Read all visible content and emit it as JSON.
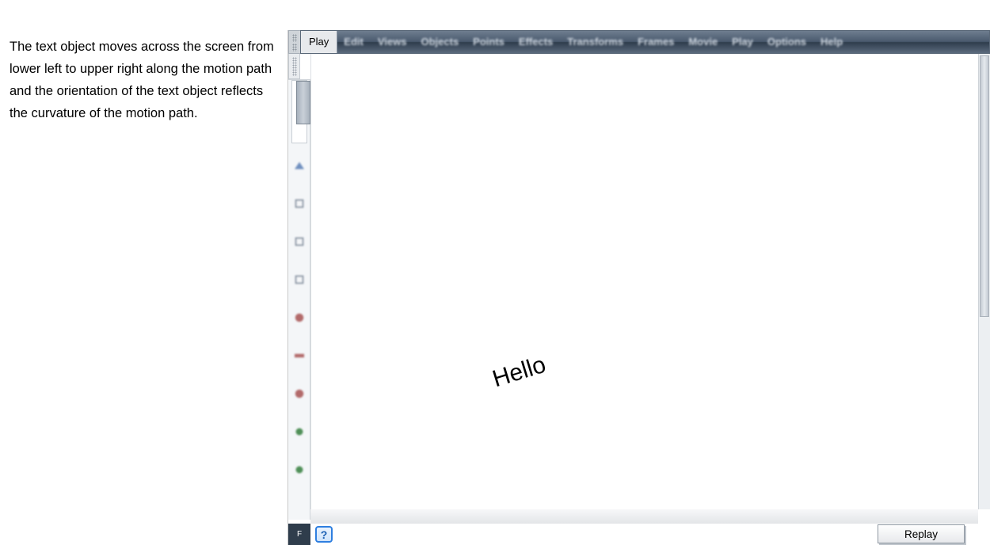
{
  "description": "The text object moves across the screen from lower left to upper right along the motion path and the orientation of the text object reflects the curvature of the motion path.",
  "menubar": {
    "items": [
      {
        "label": "Play",
        "active": true
      },
      {
        "label": "Edit",
        "active": false
      },
      {
        "label": "Views",
        "active": false
      },
      {
        "label": "Objects",
        "active": false
      },
      {
        "label": "Points",
        "active": false
      },
      {
        "label": "Effects",
        "active": false
      },
      {
        "label": "Transforms",
        "active": false
      },
      {
        "label": "Frames",
        "active": false
      },
      {
        "label": "Movie",
        "active": false
      },
      {
        "label": "Play",
        "active": false
      },
      {
        "label": "Options",
        "active": false
      },
      {
        "label": "Help",
        "active": false
      }
    ]
  },
  "canvas": {
    "text_object": "Hello"
  },
  "statusbar": {
    "left_label": "F",
    "help_label": "?",
    "replay_label": "Replay"
  },
  "toolbox": {
    "items": [
      {
        "name": "scroll-thumb"
      },
      {
        "name": "tool-a"
      },
      {
        "name": "tool-b"
      },
      {
        "name": "tool-c"
      },
      {
        "name": "tool-d"
      },
      {
        "name": "tool-e"
      },
      {
        "name": "tool-f"
      },
      {
        "name": "tool-g"
      },
      {
        "name": "tool-h"
      },
      {
        "name": "tool-i"
      }
    ]
  }
}
